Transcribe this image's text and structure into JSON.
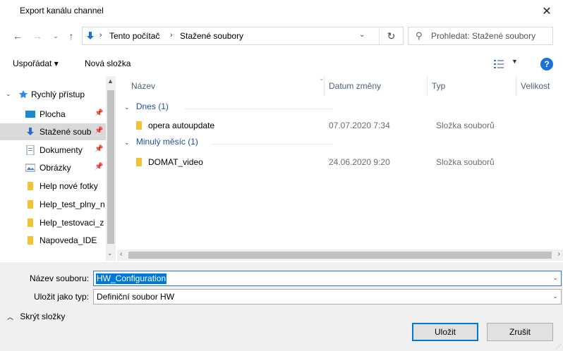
{
  "window": {
    "title": "Export kanálu channel"
  },
  "nav": {
    "back_icon": "arrow-left-icon",
    "forward_icon": "arrow-right-icon",
    "recent_icon": "chevron-down-icon",
    "up_icon": "arrow-up-icon",
    "breadcrumbs": [
      "Tento počítač",
      "Stažené soubory"
    ],
    "search_placeholder": "Prohledat: Stažené soubory"
  },
  "toolbar": {
    "organize_label": "Uspořádat ▾",
    "new_folder_label": "Nová složka",
    "help_label": "?"
  },
  "sidebar": {
    "items": [
      {
        "label": "Rychlý přístup",
        "icon": "star-icon"
      },
      {
        "label": "Plocha",
        "icon": "desktop-icon",
        "pinned": true
      },
      {
        "label": "Stažené soub",
        "icon": "download-icon",
        "pinned": true,
        "selected": true
      },
      {
        "label": "Dokumenty",
        "icon": "documents-icon",
        "pinned": true
      },
      {
        "label": "Obrázky",
        "icon": "pictures-icon",
        "pinned": true
      },
      {
        "label": "Help nové fotky",
        "icon": "folder-icon"
      },
      {
        "label": "Help_test_plny_n",
        "icon": "folder-icon"
      },
      {
        "label": "Help_testovaci_z",
        "icon": "folder-icon"
      },
      {
        "label": "Napoveda_IDE",
        "icon": "folder-icon"
      }
    ]
  },
  "filelist": {
    "columns": [
      "Název",
      "Datum změny",
      "Typ",
      "Velikost"
    ],
    "groups": [
      {
        "label": "Dnes (1)",
        "rows": [
          {
            "name": "opera autoupdate",
            "date": "07.07.2020 7:34",
            "type": "Složka souborů"
          }
        ]
      },
      {
        "label": "Minulý měsíc (1)",
        "rows": [
          {
            "name": "DOMAT_video",
            "date": "24.06.2020 9:20",
            "type": "Složka souborů"
          }
        ]
      }
    ]
  },
  "form": {
    "filename_label": "Název souboru:",
    "filename_value": "HW_Configuration",
    "filetype_label": "Uložit jako typ:",
    "filetype_value": "Definiční soubor HW",
    "hide_folders_label": "Skrýt složky",
    "save_label": "Uložit",
    "cancel_label": "Zrušit"
  },
  "colors": {
    "accent": "#0078d7",
    "selection": "#d9d9d9",
    "group_text": "#1e50a0",
    "folder": "#f2c233"
  }
}
